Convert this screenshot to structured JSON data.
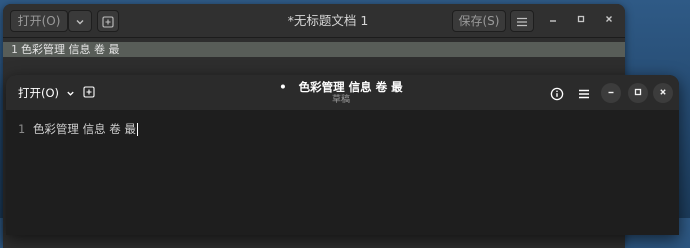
{
  "back_window": {
    "open_label": "打开(O)",
    "title": "*无标题文档 1",
    "save_label": "保存(S)",
    "line_number": "1",
    "line_text": "色彩管理 信息 卷 最"
  },
  "front_window": {
    "open_label": "打开(O)",
    "modified_dot": "•",
    "title": "色彩管理 信息 卷 最",
    "subtitle": "草稿",
    "line_number": "1",
    "line_text": "色彩管理 信息 卷 最"
  },
  "icons": {
    "chevron": "chevron-down-icon",
    "new_tab": "new-tab-icon",
    "menu": "hamburger-menu-icon",
    "info": "info-icon",
    "minimize": "minimize-icon",
    "maximize": "maximize-icon",
    "close": "close-icon"
  }
}
